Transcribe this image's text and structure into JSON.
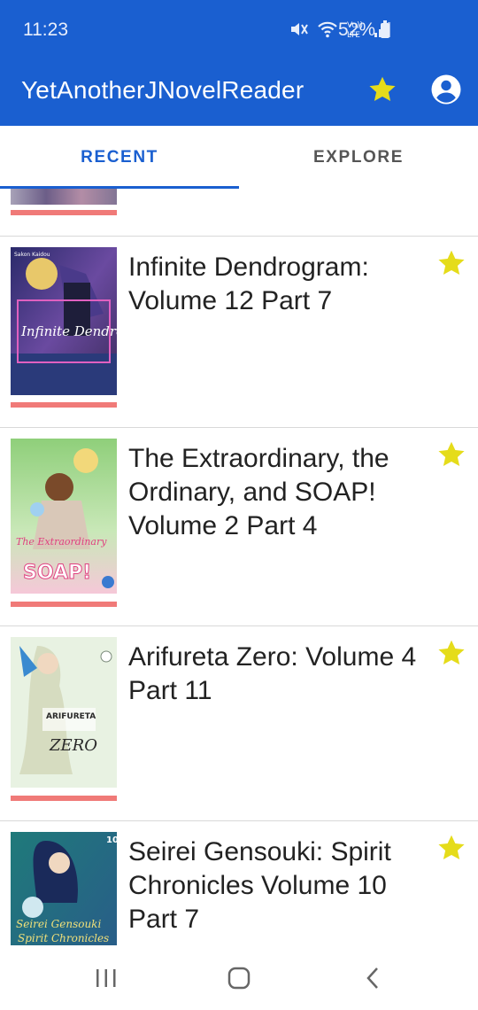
{
  "status": {
    "time": "11:23",
    "battery": "52%",
    "icons": [
      "mute-icon",
      "wifi-icon",
      "volte-icon",
      "signal-icon",
      "battery-icon"
    ]
  },
  "app": {
    "title": "YetAnotherJNovelReader"
  },
  "tabs": [
    {
      "label": "RECENT",
      "selected": true
    },
    {
      "label": "EXPLORE",
      "selected": false
    }
  ],
  "items": [
    {
      "title": "Infinite Dendrogram: Volume 12 Part 7",
      "cover_text": "Infinite Dendrogram",
      "cover_author": "Sakon Kaidou",
      "starred": true
    },
    {
      "title": "The Extraordinary, the Ordinary, and SOAP! Volume 2 Part 4",
      "cover_text": "SOAP!",
      "starred": true
    },
    {
      "title": "Arifureta Zero: Volume 4 Part 11",
      "cover_text": "ZERO",
      "starred": true
    },
    {
      "title": "Seirei Gensouki: Spirit Chronicles Volume 10 Part 7",
      "cover_text": "Seirei Gensouki",
      "starred": true
    }
  ],
  "colors": {
    "primary": "#1a5fd0",
    "star": "#e5dc1a",
    "progress": "#f07a78"
  }
}
